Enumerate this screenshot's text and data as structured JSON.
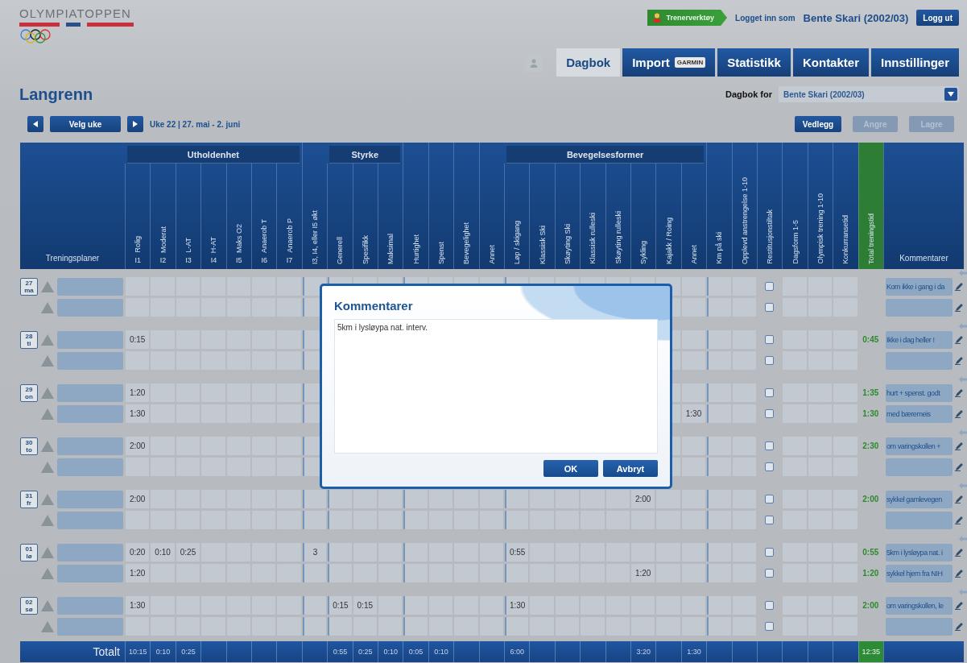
{
  "logo": {
    "text": "OLYMPIATOPPEN"
  },
  "user_bar": {
    "tool_button": "Trenerverktøy",
    "login_prefix": "Logget inn som",
    "user": "Bente Skari (2002/03)",
    "logout": "Logg ut"
  },
  "tabs": [
    {
      "label": "Dagbok",
      "selected": true
    },
    {
      "label": "Import",
      "badge": "GARMIN",
      "selected": false
    },
    {
      "label": "Statistikk",
      "selected": false
    },
    {
      "label": "Kontakter",
      "selected": false
    },
    {
      "label": "Innstillinger",
      "selected": false
    }
  ],
  "page": {
    "title": "Langrenn",
    "diary_for_label": "Dagbok for",
    "diary_for_value": "Bente Skari (2002/03)"
  },
  "week_bar": {
    "choose_week": "Velg uke",
    "week": "Uke 22 | 27. mai - 2. juni",
    "buttons": [
      {
        "label": "Vedlegg",
        "disabled": false
      },
      {
        "label": "Angre",
        "disabled": true
      },
      {
        "label": "Lagre",
        "disabled": true
      }
    ]
  },
  "table": {
    "plans_label": "Treningsplaner",
    "comments_label": "Kommentarer",
    "groups": [
      {
        "title": "Utholdenhet",
        "columns": [
          {
            "label": "Rolig",
            "code": "I1",
            "kind": "time"
          },
          {
            "label": "Moderat",
            "code": "I2",
            "kind": "time"
          },
          {
            "label": "L-AT",
            "code": "I3",
            "kind": "time"
          },
          {
            "label": "H-AT",
            "code": "I4",
            "kind": "time"
          },
          {
            "label": "Maks O2",
            "code": "I5",
            "kind": "time"
          },
          {
            "label": "Anaerob T",
            "code": "I6",
            "kind": "time"
          },
          {
            "label": "Anaerob P",
            "code": "I7",
            "kind": "time"
          }
        ]
      },
      {
        "columns": [
          {
            "label": "I3, I4, eller I5 økt",
            "kind": "time"
          }
        ]
      },
      {
        "title": "Styrke",
        "columns": [
          {
            "label": "Generell",
            "kind": "time"
          },
          {
            "label": "Spesifikk",
            "kind": "time"
          },
          {
            "label": "Maksimal",
            "kind": "time"
          }
        ]
      },
      {
        "columns": [
          {
            "label": "Hurtighet",
            "kind": "time"
          },
          {
            "label": "Spenst",
            "kind": "time"
          },
          {
            "label": "Bevegelighet",
            "kind": "time"
          },
          {
            "label": "Annet",
            "kind": "time"
          }
        ]
      },
      {
        "title": "Bevegelsesformer",
        "columns": [
          {
            "label": "Løp / skigang",
            "kind": "time"
          },
          {
            "label": "Klassisk Ski",
            "kind": "time"
          },
          {
            "label": "Skøyting Ski",
            "kind": "time"
          },
          {
            "label": "Klassisk rulleski",
            "kind": "time"
          },
          {
            "label": "Skøyting rulleski",
            "kind": "time"
          },
          {
            "label": "Sykling",
            "kind": "time"
          },
          {
            "label": "Kajakk / Roing",
            "kind": "time"
          },
          {
            "label": "Annet",
            "kind": "time"
          }
        ]
      },
      {
        "columns": [
          {
            "label": "Km på ski",
            "kind": "time"
          },
          {
            "label": "Opplevd anstrengelse 1-10",
            "kind": "time"
          },
          {
            "label": "Restitusjonstiltak",
            "kind": "check"
          },
          {
            "label": "Dagsform 1-5",
            "kind": "time"
          },
          {
            "label": "Olympisk trening 1-10",
            "kind": "time"
          },
          {
            "label": "Konkurransetid",
            "kind": "time"
          },
          {
            "label": "Total treningstid",
            "kind": "total"
          }
        ]
      }
    ],
    "days": [
      {
        "date": "27",
        "weekday": "ma",
        "rows": [
          {
            "cells": [
              {
                "kind": "blank"
              },
              {
                "kind": "blank"
              },
              {
                "kind": "blank"
              },
              {
                "kind": "blank"
              },
              {
                "kind": "blank"
              },
              {
                "kind": "blank"
              },
              {
                "kind": "blank"
              },
              {
                "kind": "blank"
              },
              {
                "kind": "blank"
              },
              {
                "kind": "blank"
              },
              {
                "kind": "blank"
              },
              {
                "kind": "blank"
              },
              {
                "kind": "blank"
              },
              {
                "kind": "blank"
              },
              {
                "kind": "blank"
              },
              {
                "kind": "blank"
              },
              {
                "kind": "blank"
              },
              {
                "kind": "blank"
              },
              {
                "kind": "blank"
              },
              {
                "kind": "blank"
              },
              {
                "kind": "blank"
              },
              {
                "kind": "blank"
              },
              {
                "kind": "blank"
              },
              {
                "kind": "blank"
              },
              {
                "kind": "blank"
              },
              {
                "kind": "check",
                "checked": false
              },
              {
                "kind": "blank"
              },
              {
                "kind": "blank"
              },
              {
                "kind": "blank"
              },
              {
                "kind": "total"
              }
            ],
            "comment": "Kom ikke i gang i da"
          },
          {
            "cells": [
              {
                "kind": "blank"
              },
              {
                "kind": "blank"
              },
              {
                "kind": "blank"
              },
              {
                "kind": "blank"
              },
              {
                "kind": "blank"
              },
              {
                "kind": "blank"
              },
              {
                "kind": "blank"
              },
              {
                "kind": "blank"
              },
              {
                "kind": "covered"
              },
              {
                "kind": "covered"
              },
              {
                "kind": "covered"
              },
              {
                "kind": "covered"
              },
              {
                "kind": "covered"
              },
              {
                "kind": "covered"
              },
              {
                "kind": "covered"
              },
              {
                "kind": "covered"
              },
              {
                "kind": "covered"
              },
              {
                "kind": "covered"
              },
              {
                "kind": "covered"
              },
              {
                "kind": "covered"
              },
              {
                "kind": "covered"
              },
              {
                "kind": "blank"
              },
              {
                "kind": "blank"
              },
              {
                "kind": "blank"
              },
              {
                "kind": "blank"
              },
              {
                "kind": "check",
                "checked": false
              },
              {
                "kind": "blank"
              },
              {
                "kind": "blank"
              },
              {
                "kind": "blank"
              },
              {
                "kind": "total"
              }
            ]
          }
        ]
      },
      {
        "date": "28",
        "weekday": "ti",
        "rows": [
          {
            "cells": [
              {
                "kind": "time",
                "value": "0:15"
              },
              {
                "kind": "blank"
              },
              {
                "kind": "blank"
              },
              {
                "kind": "blank"
              },
              {
                "kind": "blank"
              },
              {
                "kind": "blank"
              },
              {
                "kind": "blank"
              },
              {
                "kind": "blank"
              },
              {
                "kind": "covered"
              },
              {
                "kind": "covered"
              },
              {
                "kind": "covered"
              },
              {
                "kind": "covered"
              },
              {
                "kind": "covered"
              },
              {
                "kind": "covered"
              },
              {
                "kind": "covered"
              },
              {
                "kind": "covered"
              },
              {
                "kind": "covered"
              },
              {
                "kind": "covered"
              },
              {
                "kind": "covered"
              },
              {
                "kind": "covered"
              },
              {
                "kind": "covered"
              },
              {
                "kind": "blank"
              },
              {
                "kind": "blank"
              },
              {
                "kind": "blank"
              },
              {
                "kind": "blank"
              },
              {
                "kind": "check",
                "checked": false
              },
              {
                "kind": "blank"
              },
              {
                "kind": "blank"
              },
              {
                "kind": "blank"
              },
              {
                "kind": "total",
                "value": "0:45"
              }
            ],
            "comment": "Ikke i dag heller !"
          },
          {
            "cells": [
              {
                "kind": "blank"
              },
              {
                "kind": "blank"
              },
              {
                "kind": "blank"
              },
              {
                "kind": "blank"
              },
              {
                "kind": "blank"
              },
              {
                "kind": "blank"
              },
              {
                "kind": "blank"
              },
              {
                "kind": "blank"
              },
              {
                "kind": "covered"
              },
              {
                "kind": "covered"
              },
              {
                "kind": "covered"
              },
              {
                "kind": "covered"
              },
              {
                "kind": "covered"
              },
              {
                "kind": "covered"
              },
              {
                "kind": "covered"
              },
              {
                "kind": "covered"
              },
              {
                "kind": "covered"
              },
              {
                "kind": "covered"
              },
              {
                "kind": "covered"
              },
              {
                "kind": "covered"
              },
              {
                "kind": "covered"
              },
              {
                "kind": "blank"
              },
              {
                "kind": "blank"
              },
              {
                "kind": "blank"
              },
              {
                "kind": "blank"
              },
              {
                "kind": "check",
                "checked": false
              },
              {
                "kind": "blank"
              },
              {
                "kind": "blank"
              },
              {
                "kind": "blank"
              },
              {
                "kind": "total"
              }
            ]
          }
        ]
      },
      {
        "date": "29",
        "weekday": "on",
        "rows": [
          {
            "cells": [
              {
                "kind": "time",
                "value": "1:20"
              },
              {
                "kind": "blank"
              },
              {
                "kind": "blank"
              },
              {
                "kind": "blank"
              },
              {
                "kind": "blank"
              },
              {
                "kind": "blank"
              },
              {
                "kind": "blank"
              },
              {
                "kind": "blank"
              },
              {
                "kind": "covered"
              },
              {
                "kind": "covered"
              },
              {
                "kind": "covered"
              },
              {
                "kind": "covered"
              },
              {
                "kind": "covered"
              },
              {
                "kind": "covered"
              },
              {
                "kind": "covered"
              },
              {
                "kind": "covered"
              },
              {
                "kind": "covered"
              },
              {
                "kind": "covered"
              },
              {
                "kind": "covered"
              },
              {
                "kind": "covered"
              },
              {
                "kind": "covered"
              },
              {
                "kind": "blank"
              },
              {
                "kind": "blank"
              },
              {
                "kind": "blank"
              },
              {
                "kind": "blank"
              },
              {
                "kind": "check",
                "checked": false
              },
              {
                "kind": "blank"
              },
              {
                "kind": "blank"
              },
              {
                "kind": "blank"
              },
              {
                "kind": "total",
                "value": "1:35"
              }
            ],
            "comment": "hurt + spenst. godt"
          },
          {
            "cells": [
              {
                "kind": "time",
                "value": "1:30"
              },
              {
                "kind": "blank"
              },
              {
                "kind": "blank"
              },
              {
                "kind": "blank"
              },
              {
                "kind": "blank"
              },
              {
                "kind": "blank"
              },
              {
                "kind": "blank"
              },
              {
                "kind": "blank"
              },
              {
                "kind": "covered"
              },
              {
                "kind": "covered"
              },
              {
                "kind": "covered"
              },
              {
                "kind": "covered"
              },
              {
                "kind": "covered"
              },
              {
                "kind": "covered"
              },
              {
                "kind": "covered"
              },
              {
                "kind": "covered"
              },
              {
                "kind": "covered"
              },
              {
                "kind": "covered"
              },
              {
                "kind": "covered"
              },
              {
                "kind": "covered"
              },
              {
                "kind": "covered"
              },
              {
                "kind": "blank"
              },
              {
                "kind": "time",
                "value": "1:30"
              },
              {
                "kind": "blank"
              },
              {
                "kind": "blank"
              },
              {
                "kind": "check",
                "checked": false
              },
              {
                "kind": "blank"
              },
              {
                "kind": "blank"
              },
              {
                "kind": "blank"
              },
              {
                "kind": "total",
                "value": "1:30"
              }
            ],
            "comment": "med bæremeis"
          }
        ]
      },
      {
        "date": "30",
        "weekday": "to",
        "rows": [
          {
            "cells": [
              {
                "kind": "time",
                "value": "2:00"
              },
              {
                "kind": "blank"
              },
              {
                "kind": "blank"
              },
              {
                "kind": "blank"
              },
              {
                "kind": "blank"
              },
              {
                "kind": "blank"
              },
              {
                "kind": "blank"
              },
              {
                "kind": "blank"
              },
              {
                "kind": "covered"
              },
              {
                "kind": "covered"
              },
              {
                "kind": "covered"
              },
              {
                "kind": "covered"
              },
              {
                "kind": "covered"
              },
              {
                "kind": "covered"
              },
              {
                "kind": "covered"
              },
              {
                "kind": "covered"
              },
              {
                "kind": "covered"
              },
              {
                "kind": "covered"
              },
              {
                "kind": "covered"
              },
              {
                "kind": "covered"
              },
              {
                "kind": "covered"
              },
              {
                "kind": "blank"
              },
              {
                "kind": "blank"
              },
              {
                "kind": "blank"
              },
              {
                "kind": "blank"
              },
              {
                "kind": "check",
                "checked": false
              },
              {
                "kind": "blank"
              },
              {
                "kind": "blank"
              },
              {
                "kind": "blank"
              },
              {
                "kind": "total",
                "value": "2:30"
              }
            ],
            "comment": "om varingskollen +"
          },
          {
            "cells": [
              {
                "kind": "blank"
              },
              {
                "kind": "blank"
              },
              {
                "kind": "blank"
              },
              {
                "kind": "blank"
              },
              {
                "kind": "blank"
              },
              {
                "kind": "blank"
              },
              {
                "kind": "blank"
              },
              {
                "kind": "blank"
              },
              {
                "kind": "covered"
              },
              {
                "kind": "covered"
              },
              {
                "kind": "covered"
              },
              {
                "kind": "covered"
              },
              {
                "kind": "covered"
              },
              {
                "kind": "covered"
              },
              {
                "kind": "covered"
              },
              {
                "kind": "covered"
              },
              {
                "kind": "covered"
              },
              {
                "kind": "covered"
              },
              {
                "kind": "covered"
              },
              {
                "kind": "covered"
              },
              {
                "kind": "covered"
              },
              {
                "kind": "blank"
              },
              {
                "kind": "blank"
              },
              {
                "kind": "blank"
              },
              {
                "kind": "blank"
              },
              {
                "kind": "check",
                "checked": false
              },
              {
                "kind": "blank"
              },
              {
                "kind": "blank"
              },
              {
                "kind": "blank"
              },
              {
                "kind": "total"
              }
            ]
          }
        ]
      },
      {
        "date": "31",
        "weekday": "fr",
        "rows": [
          {
            "cells": [
              {
                "kind": "time",
                "value": "2:00"
              },
              {
                "kind": "blank"
              },
              {
                "kind": "blank"
              },
              {
                "kind": "blank"
              },
              {
                "kind": "blank"
              },
              {
                "kind": "blank"
              },
              {
                "kind": "blank"
              },
              {
                "kind": "blank"
              },
              {
                "kind": "blank"
              },
              {
                "kind": "blank"
              },
              {
                "kind": "blank"
              },
              {
                "kind": "blank"
              },
              {
                "kind": "blank"
              },
              {
                "kind": "blank"
              },
              {
                "kind": "blank"
              },
              {
                "kind": "blank"
              },
              {
                "kind": "blank"
              },
              {
                "kind": "blank"
              },
              {
                "kind": "blank"
              },
              {
                "kind": "blank"
              },
              {
                "kind": "time",
                "value": "2:00"
              },
              {
                "kind": "blank"
              },
              {
                "kind": "blank"
              },
              {
                "kind": "blank"
              },
              {
                "kind": "blank"
              },
              {
                "kind": "check",
                "checked": false
              },
              {
                "kind": "blank"
              },
              {
                "kind": "blank"
              },
              {
                "kind": "blank"
              },
              {
                "kind": "total",
                "value": "2:00"
              }
            ],
            "comment": "sykkel gamlevegen"
          },
          {
            "cells": [
              {
                "kind": "blank"
              },
              {
                "kind": "blank"
              },
              {
                "kind": "blank"
              },
              {
                "kind": "blank"
              },
              {
                "kind": "blank"
              },
              {
                "kind": "blank"
              },
              {
                "kind": "blank"
              },
              {
                "kind": "blank"
              },
              {
                "kind": "blank"
              },
              {
                "kind": "blank"
              },
              {
                "kind": "blank"
              },
              {
                "kind": "blank"
              },
              {
                "kind": "blank"
              },
              {
                "kind": "blank"
              },
              {
                "kind": "blank"
              },
              {
                "kind": "blank"
              },
              {
                "kind": "blank"
              },
              {
                "kind": "blank"
              },
              {
                "kind": "blank"
              },
              {
                "kind": "blank"
              },
              {
                "kind": "blank"
              },
              {
                "kind": "blank"
              },
              {
                "kind": "blank"
              },
              {
                "kind": "blank"
              },
              {
                "kind": "blank"
              },
              {
                "kind": "check",
                "checked": false
              },
              {
                "kind": "blank"
              },
              {
                "kind": "blank"
              },
              {
                "kind": "blank"
              },
              {
                "kind": "total"
              }
            ]
          }
        ]
      },
      {
        "date": "01",
        "weekday": "lø",
        "rows": [
          {
            "cells": [
              {
                "kind": "time",
                "value": "0:20"
              },
              {
                "kind": "time",
                "value": "0:10"
              },
              {
                "kind": "time",
                "value": "0:25"
              },
              {
                "kind": "blank"
              },
              {
                "kind": "blank"
              },
              {
                "kind": "blank"
              },
              {
                "kind": "blank"
              },
              {
                "kind": "time",
                "value": "3"
              },
              {
                "kind": "blank"
              },
              {
                "kind": "blank"
              },
              {
                "kind": "blank"
              },
              {
                "kind": "blank"
              },
              {
                "kind": "blank"
              },
              {
                "kind": "blank"
              },
              {
                "kind": "blank"
              },
              {
                "kind": "time",
                "value": "0:55"
              },
              {
                "kind": "blank"
              },
              {
                "kind": "blank"
              },
              {
                "kind": "blank"
              },
              {
                "kind": "blank"
              },
              {
                "kind": "blank"
              },
              {
                "kind": "blank"
              },
              {
                "kind": "blank"
              },
              {
                "kind": "blank"
              },
              {
                "kind": "blank"
              },
              {
                "kind": "check",
                "checked": false
              },
              {
                "kind": "blank"
              },
              {
                "kind": "blank"
              },
              {
                "kind": "blank"
              },
              {
                "kind": "total",
                "value": "0:55"
              }
            ],
            "comment": "5km i lysløypa nat. i"
          },
          {
            "cells": [
              {
                "kind": "time",
                "value": "1:20"
              },
              {
                "kind": "blank"
              },
              {
                "kind": "blank"
              },
              {
                "kind": "blank"
              },
              {
                "kind": "blank"
              },
              {
                "kind": "blank"
              },
              {
                "kind": "blank"
              },
              {
                "kind": "blank"
              },
              {
                "kind": "blank"
              },
              {
                "kind": "blank"
              },
              {
                "kind": "blank"
              },
              {
                "kind": "blank"
              },
              {
                "kind": "blank"
              },
              {
                "kind": "blank"
              },
              {
                "kind": "blank"
              },
              {
                "kind": "blank"
              },
              {
                "kind": "blank"
              },
              {
                "kind": "blank"
              },
              {
                "kind": "blank"
              },
              {
                "kind": "blank"
              },
              {
                "kind": "time",
                "value": "1:20"
              },
              {
                "kind": "blank"
              },
              {
                "kind": "blank"
              },
              {
                "kind": "blank"
              },
              {
                "kind": "blank"
              },
              {
                "kind": "check",
                "checked": false
              },
              {
                "kind": "blank"
              },
              {
                "kind": "blank"
              },
              {
                "kind": "blank"
              },
              {
                "kind": "total",
                "value": "1:20"
              }
            ],
            "comment": "sykkel hjem fra NIH"
          }
        ]
      },
      {
        "date": "02",
        "weekday": "sø",
        "rows": [
          {
            "cells": [
              {
                "kind": "time",
                "value": "1:30"
              },
              {
                "kind": "blank"
              },
              {
                "kind": "blank"
              },
              {
                "kind": "blank"
              },
              {
                "kind": "blank"
              },
              {
                "kind": "blank"
              },
              {
                "kind": "blank"
              },
              {
                "kind": "blank"
              },
              {
                "kind": "time",
                "value": "0:15"
              },
              {
                "kind": "time",
                "value": "0:15"
              },
              {
                "kind": "blank"
              },
              {
                "kind": "blank"
              },
              {
                "kind": "blank"
              },
              {
                "kind": "blank"
              },
              {
                "kind": "blank"
              },
              {
                "kind": "time",
                "value": "1:30"
              },
              {
                "kind": "blank"
              },
              {
                "kind": "blank"
              },
              {
                "kind": "blank"
              },
              {
                "kind": "blank"
              },
              {
                "kind": "blank"
              },
              {
                "kind": "blank"
              },
              {
                "kind": "blank"
              },
              {
                "kind": "blank"
              },
              {
                "kind": "blank"
              },
              {
                "kind": "check",
                "checked": false
              },
              {
                "kind": "blank"
              },
              {
                "kind": "blank"
              },
              {
                "kind": "blank"
              },
              {
                "kind": "total",
                "value": "2:00"
              }
            ],
            "comment": "om varingskollen, le"
          },
          {
            "cells": [
              {
                "kind": "blank"
              },
              {
                "kind": "blank"
              },
              {
                "kind": "blank"
              },
              {
                "kind": "blank"
              },
              {
                "kind": "blank"
              },
              {
                "kind": "blank"
              },
              {
                "kind": "blank"
              },
              {
                "kind": "blank"
              },
              {
                "kind": "blank"
              },
              {
                "kind": "blank"
              },
              {
                "kind": "blank"
              },
              {
                "kind": "blank"
              },
              {
                "kind": "blank"
              },
              {
                "kind": "blank"
              },
              {
                "kind": "blank"
              },
              {
                "kind": "blank"
              },
              {
                "kind": "blank"
              },
              {
                "kind": "blank"
              },
              {
                "kind": "blank"
              },
              {
                "kind": "blank"
              },
              {
                "kind": "blank"
              },
              {
                "kind": "blank"
              },
              {
                "kind": "blank"
              },
              {
                "kind": "blank"
              },
              {
                "kind": "blank"
              },
              {
                "kind": "check",
                "checked": false
              },
              {
                "kind": "blank"
              },
              {
                "kind": "blank"
              },
              {
                "kind": "blank"
              },
              {
                "kind": "total"
              }
            ]
          }
        ]
      }
    ],
    "totals": {
      "label": "Totalt",
      "cells": [
        {
          "kind": "time",
          "value": "10:15"
        },
        {
          "kind": "time",
          "value": "0:10"
        },
        {
          "kind": "time",
          "value": "0:25"
        },
        {
          "kind": "blank"
        },
        {
          "kind": "blank"
        },
        {
          "kind": "blank"
        },
        {
          "kind": "blank"
        },
        {
          "kind": "blank"
        },
        {
          "kind": "time",
          "value": "0:55"
        },
        {
          "kind": "time",
          "value": "0:25"
        },
        {
          "kind": "time",
          "value": "0:10"
        },
        {
          "kind": "time",
          "value": "0:05"
        },
        {
          "kind": "time",
          "value": "0:10"
        },
        {
          "kind": "blank"
        },
        {
          "kind": "blank"
        },
        {
          "kind": "time",
          "value": "6:00"
        },
        {
          "kind": "blank"
        },
        {
          "kind": "blank"
        },
        {
          "kind": "blank"
        },
        {
          "kind": "blank"
        },
        {
          "kind": "time",
          "value": "3:20"
        },
        {
          "kind": "blank"
        },
        {
          "kind": "time",
          "value": "1:30"
        },
        {
          "kind": "blank"
        },
        {
          "kind": "blank"
        },
        {
          "kind": "blank"
        },
        {
          "kind": "blank"
        },
        {
          "kind": "blank"
        },
        {
          "kind": "blank"
        },
        {
          "kind": "total",
          "value": "12:35"
        }
      ]
    }
  },
  "dialog": {
    "title": "Kommentarer",
    "text": "5km i lysløypa nat. interv.",
    "buttons": [
      "OK",
      "Avbryt"
    ]
  }
}
